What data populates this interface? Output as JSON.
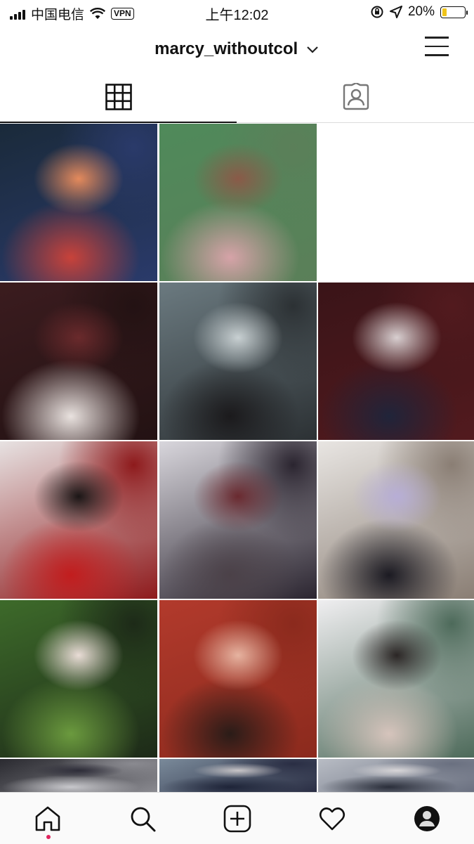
{
  "status_bar": {
    "carrier": "中国电信",
    "vpn": "VPN",
    "time": "上午12:02",
    "battery": "20%",
    "battery_level": 0.2
  },
  "header": {
    "username": "marcy_withoutcol"
  },
  "tabs": {
    "active": "grid"
  },
  "photos": [
    {
      "colors": [
        "#1a2a3a",
        "#c8423a",
        "#e48a5c",
        "#2a3a6a"
      ]
    },
    {
      "colors": [
        "#4f8a5a",
        "#d6a3a8",
        "#8a5a48",
        "#5b7f59"
      ]
    },
    {
      "colors": [
        "#0d0b0c",
        "#3a2d2e",
        "#d7c6c0",
        "#111"
      ]
    },
    {
      "colors": [
        "#3b1c1f",
        "#e9e2df",
        "#6a2a2c",
        "#231213"
      ]
    },
    {
      "colors": [
        "#6b7a80",
        "#1b1a1c",
        "#c8d0d2",
        "#2c3134"
      ]
    },
    {
      "colors": [
        "#3a1418",
        "#20243a",
        "#d8cfd0",
        "#521a1e"
      ]
    },
    {
      "colors": [
        "#e7e2e2",
        "#c21d1e",
        "#1b1616",
        "#8e1a1c"
      ]
    },
    {
      "colors": [
        "#d8d6dc",
        "#4b4148",
        "#6a2a30",
        "#2b2530"
      ]
    },
    {
      "colors": [
        "#e8e5e2",
        "#1b1a22",
        "#b7aed6",
        "#8a7e74"
      ]
    },
    {
      "colors": [
        "#3d6a2a",
        "#6b9a3e",
        "#e9dcd6",
        "#1d2a18"
      ]
    },
    {
      "colors": [
        "#b23a2c",
        "#2a1c18",
        "#e6b3a0",
        "#8b2a1d"
      ]
    },
    {
      "colors": [
        "#efeef0",
        "#d6c4bc",
        "#2b2625",
        "#4d6a5a"
      ]
    },
    {
      "colors": [
        "#2a2a30",
        "#c8c8cc",
        "#2d2c38",
        "#8a8a90"
      ]
    },
    {
      "colors": [
        "#7a8a9a",
        "#1e2438",
        "#c9c6c8",
        "#2a2e44"
      ]
    },
    {
      "colors": [
        "#b8bcc4",
        "#2a2e3a",
        "#d8d6d8",
        "#6a7080"
      ]
    }
  ]
}
